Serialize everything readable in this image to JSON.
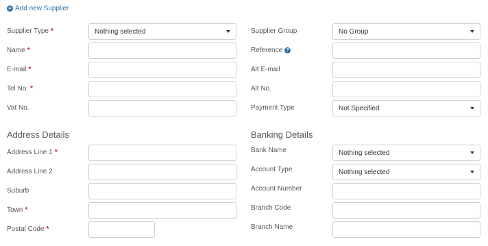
{
  "add_supplier_label": "Add new Supplier",
  "icons": {
    "add": "plus-circle-icon",
    "help": "question-circle-icon"
  },
  "form_left": {
    "supplier_type": {
      "label": "Supplier Type",
      "value": "Nothing selected"
    },
    "name": {
      "label": "Name",
      "value": ""
    },
    "email": {
      "label": "E-mail",
      "value": ""
    },
    "tel": {
      "label": "Tel No.",
      "value": ""
    },
    "vat": {
      "label": "Vat No.",
      "value": ""
    }
  },
  "form_right": {
    "supplier_group": {
      "label": "Supplier Group",
      "value": "No Group"
    },
    "reference": {
      "label": "Reference",
      "value": ""
    },
    "alt_email": {
      "label": "Alt E-mail",
      "value": ""
    },
    "alt_no": {
      "label": "Alt No.",
      "value": ""
    },
    "payment_type": {
      "label": "Payment Type",
      "value": "Not Specified"
    }
  },
  "address": {
    "title": "Address Details",
    "line1": {
      "label": "Address Line 1",
      "value": ""
    },
    "line2": {
      "label": "Address Line 2",
      "value": ""
    },
    "suburb": {
      "label": "Suburb",
      "value": ""
    },
    "town": {
      "label": "Town",
      "value": ""
    },
    "postal_code": {
      "label": "Postal Code",
      "value": ""
    }
  },
  "banking": {
    "title": "Banking Details",
    "bank_name": {
      "label": "Bank Name",
      "value": "Nothing selected"
    },
    "account_type": {
      "label": "Account Type",
      "value": "Nothing selected"
    },
    "account_number": {
      "label": "Account Number",
      "value": ""
    },
    "branch_code": {
      "label": "Branch Code",
      "value": ""
    },
    "branch_name": {
      "label": "Branch Name",
      "value": ""
    }
  },
  "required_marker": "*",
  "colors": {
    "link": "#2a6fa8",
    "required": "#cc2222",
    "border": "#cfcfcf"
  }
}
